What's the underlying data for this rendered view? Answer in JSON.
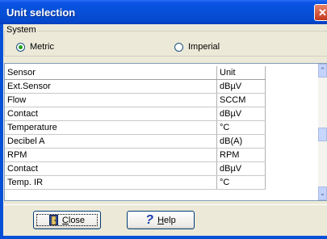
{
  "window": {
    "title": "Unit selection",
    "close_glyph": "✕"
  },
  "system": {
    "label": "System",
    "options": [
      {
        "label": "Metric",
        "selected": true
      },
      {
        "label": "Imperial",
        "selected": false
      }
    ]
  },
  "table": {
    "columns": [
      "Sensor",
      "Unit"
    ],
    "rows": [
      [
        "Ext.Sensor",
        "dBµV"
      ],
      [
        "Flow",
        "SCCM"
      ],
      [
        "Contact",
        "dBµV"
      ],
      [
        "Temperature",
        "°C"
      ],
      [
        "Decibel A",
        "dB(A)"
      ],
      [
        "RPM",
        "RPM"
      ],
      [
        "Contact",
        "dBµV"
      ],
      [
        "Temp. IR",
        "°C"
      ]
    ]
  },
  "scrollbar": {
    "up_glyph": "⌃",
    "down_glyph": "⌄"
  },
  "buttons": {
    "close": {
      "prefix": "",
      "mnemonic": "C",
      "rest": "lose",
      "icon": "exit-door-icon"
    },
    "help": {
      "mnemonic": "H",
      "rest": "elp",
      "icon": "help-question-icon",
      "glyph": "?"
    }
  },
  "colors": {
    "title_bar": "#0650d8",
    "dialog_bg": "#ece9d8",
    "close_button": "#c3371a"
  }
}
